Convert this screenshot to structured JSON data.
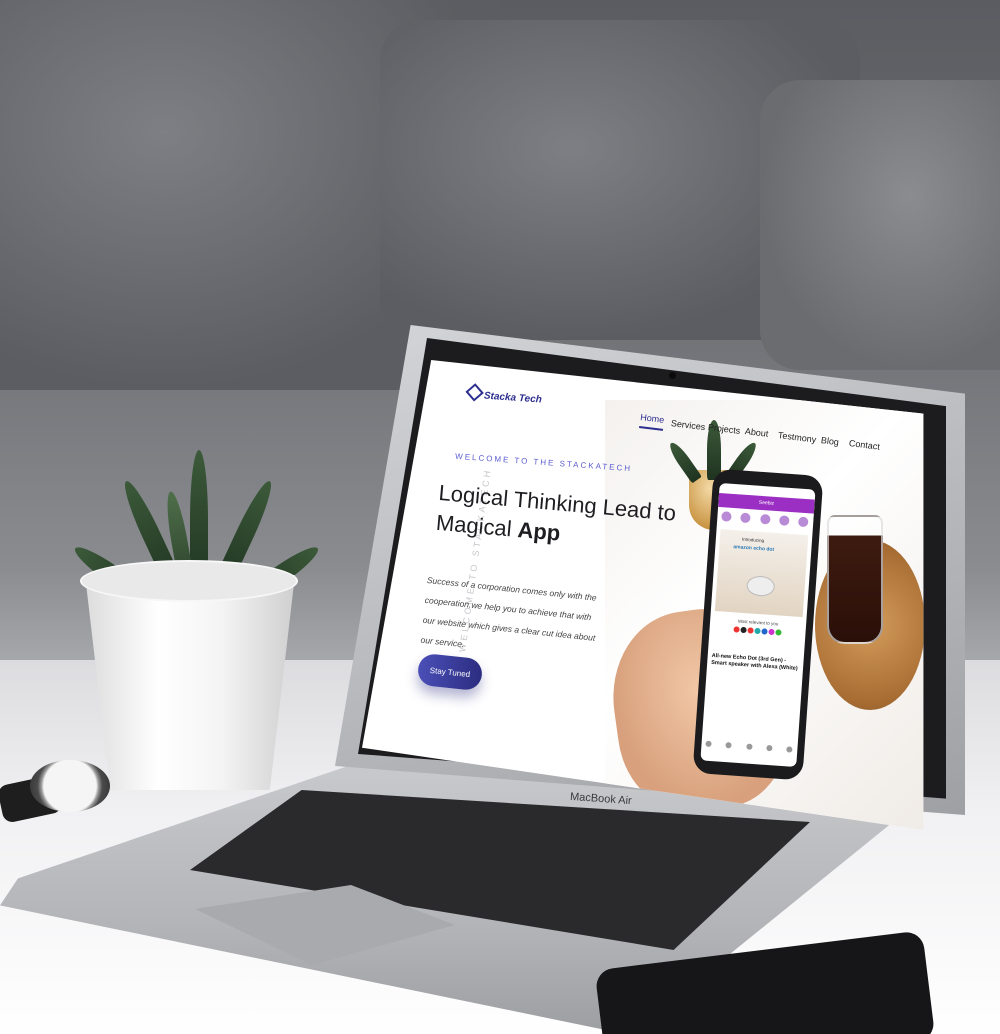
{
  "website": {
    "logo_text": "Stacka Tech",
    "nav": [
      "Home",
      "Services",
      "Projects",
      "About",
      "Testmony",
      "Blog",
      "Contact"
    ],
    "eyebrow": "WELCOME TO THE STACKATECH",
    "vertical_text": "WELCOME TO STACKATECH",
    "headline_line1": "Logical Thinking Lead to",
    "headline_line2_prefix": "Magical ",
    "headline_line2_bold": "App",
    "body_copy": "Success of a corporation comes only with the cooperation.we help you to achieve that with our website which gives a clear cut idea about our service.",
    "cta_label": "Stay Tuned"
  },
  "phone_app": {
    "header": "Seebiz",
    "promo_small": "Introducing",
    "promo_brand": "amazon echo dot",
    "product_title": "All-new Echo Dot (3rd Gen) - Smart speaker with Alexa (White)",
    "section_label": "Most relevant to you"
  },
  "laptop_label": "MacBook Air",
  "colors": {
    "brand": "#2d2f8f",
    "accent": "#5a5cd0",
    "app_bar": "#9b2fc4"
  }
}
